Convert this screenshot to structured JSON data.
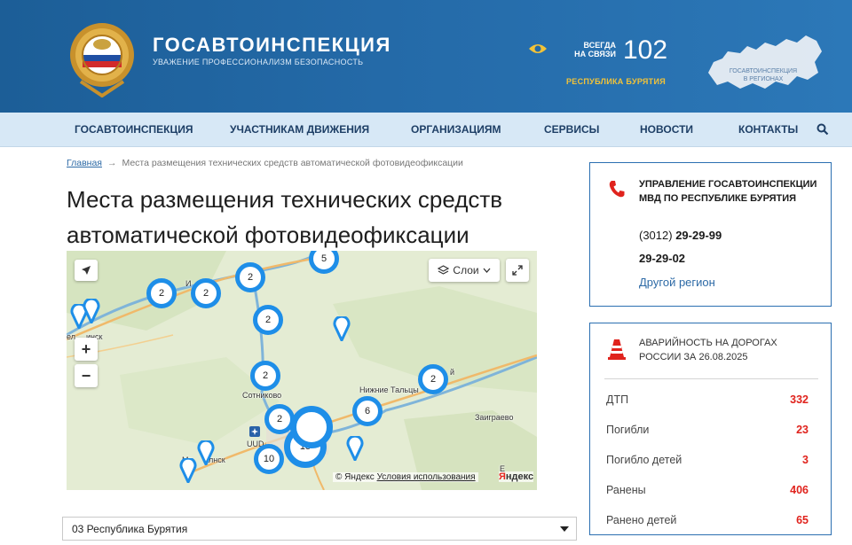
{
  "header": {
    "brand_title": "ГОСАВТОИНСПЕКЦИЯ",
    "brand_subtitle": "УВАЖЕНИЕ ПРОФЕССИОНАЛИЗМ БЕЗОПАСНОСТЬ",
    "always_line1": "ВСЕГДА",
    "always_line2": "НА СВЯЗИ",
    "hotline": "102",
    "region": "РЕСПУБЛИКА БУРЯТИЯ",
    "map_label_line1": "ГОСАВТОИНСПЕКЦИЯ",
    "map_label_line2": "В РЕГИОНАХ"
  },
  "nav": {
    "items": [
      "ГОСАВТОИНСПЕКЦИЯ",
      "УЧАСТНИКАМ ДВИЖЕНИЯ",
      "ОРГАНИЗАЦИЯМ",
      "СЕРВИСЫ",
      "НОВОСТИ",
      "КОНТАКТЫ"
    ]
  },
  "breadcrumb": {
    "home": "Главная",
    "separator": "→",
    "current": "Места размещения технических средств автоматической фотовидеофиксации"
  },
  "page": {
    "title": "Места размещения технических средств автоматической фотовидеофиксации"
  },
  "map": {
    "layers_label": "Слои",
    "zoom_in": "+",
    "zoom_out": "−",
    "clusters": [
      "5",
      "2",
      "2",
      "2",
      "2",
      "2",
      "2",
      "6",
      "2",
      "15",
      "10",
      "2"
    ],
    "places": {
      "a": "ел",
      "b": "инск",
      "c": "И",
      "d": "Сотниково",
      "e": "Нижние Тальцы",
      "f": "Заиграево",
      "g": "UUD",
      "h": "Мо",
      "i": "лнск",
      "j": "Е",
      "k": "й"
    },
    "copyright": "© Яндекс",
    "terms": "Условия использования",
    "logo_y": "Я",
    "logo_rest": "ндекс"
  },
  "region_select": {
    "value": "03 Республика Бурятия"
  },
  "contact": {
    "title": "УПРАВЛЕНИЕ ГОСАВТОИНСПЕКЦИИ МВД ПО РЕСПУБЛИКЕ БУРЯТИЯ",
    "code": "(3012)",
    "phone1": "29-29-99",
    "phone2": "29-29-02",
    "other_region": "Другой регион"
  },
  "accidents": {
    "title": "АВАРИЙНОСТЬ НА ДОРОГАХ РОССИИ ЗА 26.08.2025",
    "rows": [
      {
        "label": "ДТП",
        "value": "332"
      },
      {
        "label": "Погибли",
        "value": "23"
      },
      {
        "label": "Погибло детей",
        "value": "3"
      },
      {
        "label": "Ранены",
        "value": "406"
      },
      {
        "label": "Ранено детей",
        "value": "65"
      }
    ]
  },
  "colors": {
    "header_blue": "#246aa8",
    "nav_bg": "#d7e8f6",
    "accent_gold": "#f3c338",
    "cluster_blue": "#1e8ee8",
    "stat_red": "#e0231d"
  }
}
